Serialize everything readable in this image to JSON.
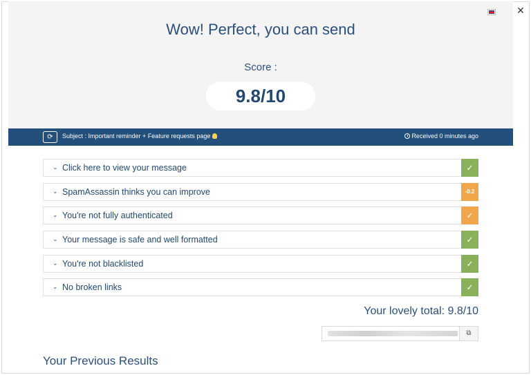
{
  "window": {
    "close_glyph": "✕",
    "language_flag": "uk-flag-icon"
  },
  "header": {
    "headline": "Wow! Perfect, you can send",
    "score_label": "Score :",
    "score_value": "9.8/10"
  },
  "subject_bar": {
    "refresh_glyph": "⟳",
    "subject_text": "Subject : Important reminder + Feature requests page",
    "received_text": "Received 0 minutes ago"
  },
  "checks": [
    {
      "label": "Click here to view your message",
      "badge": "✓",
      "status": "pass",
      "color": "#8bb05a"
    },
    {
      "label": "SpamAssassin thinks you can improve",
      "badge": "-0.2",
      "status": "warning",
      "color": "#f2a64a"
    },
    {
      "label": "You're not fully authenticated",
      "badge": "✓",
      "status": "warning",
      "color": "#f2a64a"
    },
    {
      "label": "Your message is safe and well formatted",
      "badge": "✓",
      "status": "pass",
      "color": "#8bb05a"
    },
    {
      "label": "You're not blacklisted",
      "badge": "✓",
      "status": "pass",
      "color": "#8bb05a"
    },
    {
      "label": "No broken links",
      "badge": "✓",
      "status": "pass",
      "color": "#8bb05a"
    }
  ],
  "chevron_glyph": "⌄",
  "total_text": "Your lovely total: 9.8/10",
  "share": {
    "copy_glyph": "⧉"
  },
  "previous_results_title": "Your Previous Results",
  "colors": {
    "primary": "#23507a",
    "pass": "#8bb05a",
    "warning": "#f2a64a"
  }
}
